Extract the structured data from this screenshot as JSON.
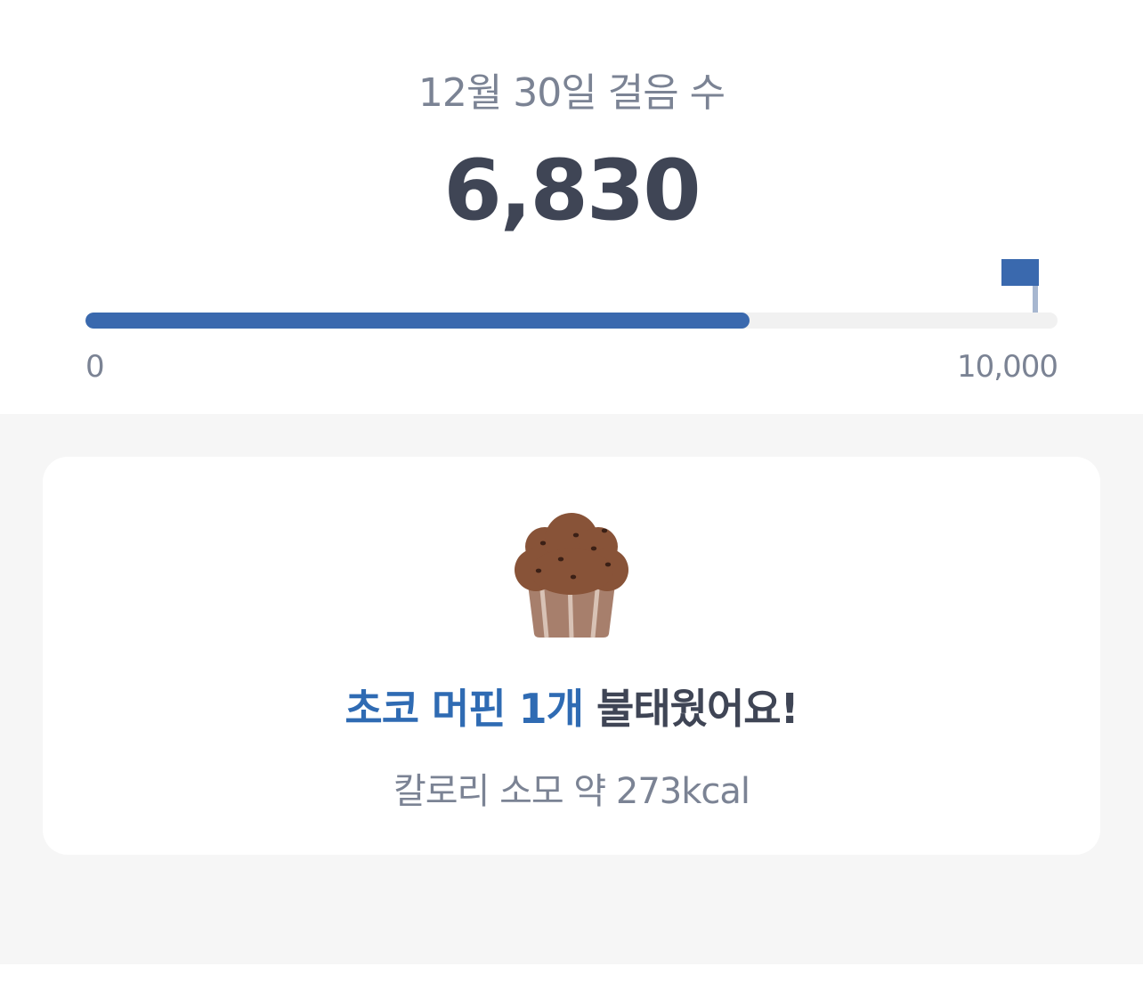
{
  "header": {
    "date_label": "12월 30일 걸음 수",
    "step_count": "6,830"
  },
  "progress": {
    "value": 6830,
    "goal": 10000,
    "fraction": 0.683,
    "min_label": "0",
    "max_label": "10,000",
    "fill_color": "#3a69ae",
    "track_color": "#f1f1f1",
    "goal_icon": "flag-icon"
  },
  "burn_card": {
    "icon": "muffin-icon",
    "food_highlight": "초코 머핀 1개",
    "burn_suffix": " 불태웠어요!",
    "calorie_text": "칼로리 소모 약 273kcal",
    "highlight_color": "#2f6bb3"
  }
}
